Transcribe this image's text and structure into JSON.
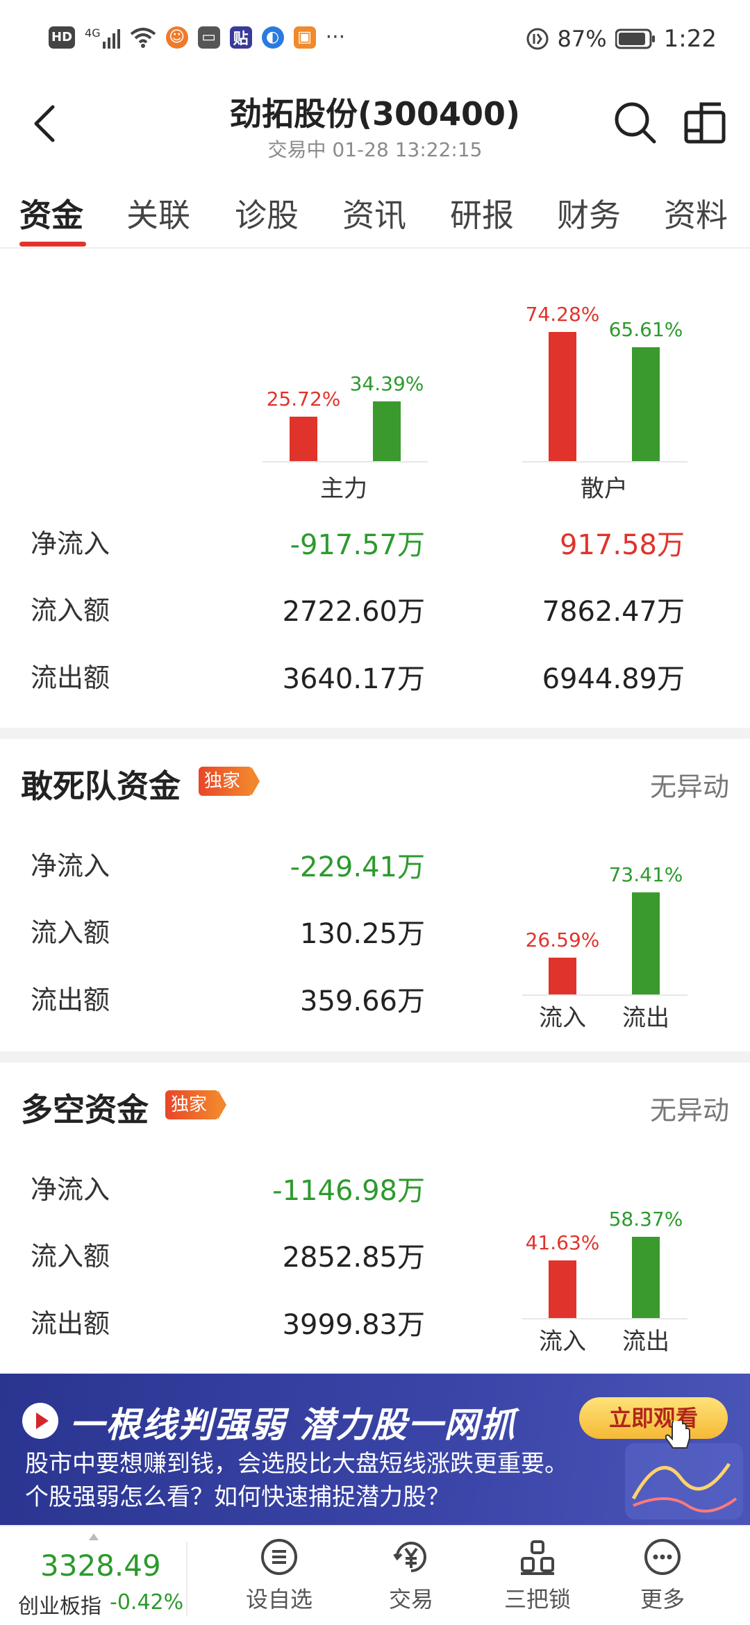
{
  "status_bar": {
    "left_icons": [
      "hd-icon",
      "signal-4g-icon",
      "wifi-icon",
      "app-notification-icon",
      "app-notification-icon",
      "app-notification-icon",
      "app-notification-icon",
      "app-notification-icon",
      "more-dots"
    ],
    "hd": "HD",
    "network": "4G",
    "battery": "87%",
    "time": "1:22",
    "more": "···"
  },
  "header": {
    "title": "劲拓股份(300400)",
    "subtitle": "交易中 01-28 13:22:15"
  },
  "tabs": [
    {
      "label": "资金",
      "active": true
    },
    {
      "label": "关联"
    },
    {
      "label": "诊股"
    },
    {
      "label": "资讯"
    },
    {
      "label": "研报"
    },
    {
      "label": "财务"
    },
    {
      "label": "资料"
    }
  ],
  "main_flow": {
    "groups": [
      {
        "label": "主力",
        "inflow_pct": "25.72%",
        "outflow_pct": "34.39%",
        "inflow_value": 25.72,
        "outflow_value": 34.39
      },
      {
        "label": "散户",
        "inflow_pct": "74.28%",
        "outflow_pct": "65.61%",
        "inflow_value": 74.28,
        "outflow_value": 65.61
      }
    ],
    "rows": [
      {
        "label": "净流入",
        "main": "-917.57万",
        "retail": "917.58万"
      },
      {
        "label": "流入额",
        "main": "2722.60万",
        "retail": "7862.47万"
      },
      {
        "label": "流出额",
        "main": "3640.17万",
        "retail": "6944.89万"
      }
    ]
  },
  "dare_to_die": {
    "title": "敢死队资金",
    "badge": "独家",
    "status": "无异动",
    "rows": [
      {
        "label": "净流入",
        "value": "-229.41万"
      },
      {
        "label": "流入额",
        "value": "130.25万"
      },
      {
        "label": "流出额",
        "value": "359.66万"
      }
    ],
    "chart": {
      "inflow_label": "流入",
      "outflow_label": "流出",
      "inflow_pct": "26.59%",
      "outflow_pct": "73.41%",
      "inflow_value": 26.59,
      "outflow_value": 73.41
    }
  },
  "long_short": {
    "title": "多空资金",
    "badge": "独家",
    "status": "无异动",
    "rows": [
      {
        "label": "净流入",
        "value": "-1146.98万"
      },
      {
        "label": "流入额",
        "value": "2852.85万"
      },
      {
        "label": "流出额",
        "value": "3999.83万"
      }
    ],
    "chart": {
      "inflow_label": "流入",
      "outflow_label": "流出",
      "inflow_pct": "41.63%",
      "outflow_pct": "58.37%",
      "inflow_value": 41.63,
      "outflow_value": 58.37
    }
  },
  "banner": {
    "title": "一根线判强弱  潜力股一网抓",
    "button": "立即观看",
    "line1": "股市中要想赚到钱，会选股比大盘短线涨跌更重要。",
    "line2": "个股强弱怎么看？如何快速捕捉潜力股？"
  },
  "bottom_nav": {
    "index_value": "3328.49",
    "index_name": "创业板指",
    "index_change": "-0.42%",
    "items": [
      {
        "label": "设自选",
        "icon": "list-icon"
      },
      {
        "label": "交易",
        "icon": "yuan-icon"
      },
      {
        "label": "三把锁",
        "icon": "locks-icon"
      },
      {
        "label": "更多",
        "icon": "more-icon"
      }
    ]
  },
  "colors": {
    "red": "#e0332b",
    "green": "#3a9a2e",
    "accent": "#e0332b",
    "banner": "#3b45a8"
  }
}
